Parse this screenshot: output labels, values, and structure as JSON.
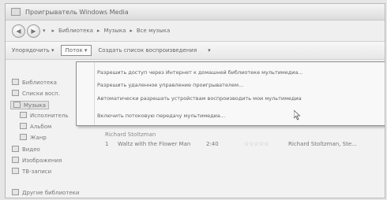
{
  "window": {
    "title": "Проигрыватель Windows Media"
  },
  "nav": {
    "back_glyph": "◀",
    "forward_glyph": "▶",
    "dropdown_glyph": "▾",
    "breadcrumbs": [
      "▸",
      "Библиотека",
      "▸",
      "Музыка",
      "▸",
      "Все музыка"
    ]
  },
  "toolbar": {
    "organize": "Упорядочить ▾",
    "stream": "Поток ▾",
    "create_playlist": "Создать список воспроизведения",
    "more": "▾"
  },
  "sidebar": {
    "items": [
      {
        "label": "Библиотека",
        "icon": "library-icon"
      },
      {
        "label": "Списки восп.",
        "icon": "playlist-icon"
      },
      {
        "label": "Музыка",
        "icon": "music-icon"
      },
      {
        "label": "Исполнитель",
        "icon": "artist-icon"
      },
      {
        "label": "Альбом",
        "icon": "album-icon"
      },
      {
        "label": "Жанр",
        "icon": "genre-icon"
      },
      {
        "label": "Видео",
        "icon": "video-icon"
      },
      {
        "label": "Изображения",
        "icon": "picture-icon"
      },
      {
        "label": "ТВ-записи",
        "icon": "tv-icon"
      },
      {
        "label": "Другие библиотеки",
        "icon": "other-libraries-icon"
      }
    ]
  },
  "library": {
    "album_artist": "Richard Stoltzman",
    "track": {
      "number": "1",
      "title": "Waltz with the Flower Man",
      "length": "2:40",
      "rating": "☆☆☆☆☆",
      "contributing_artist": "Richard Stoltzman, Ste..."
    }
  },
  "stream_menu": {
    "items": [
      "Разрешить доступ через Интернет к домашней библиотеке мультимедиа...",
      "Разрешить удаленное управление проигрывателем...",
      "Автоматически разрешать устройствам воспроизводить мои мультимедиа",
      "Включить потоковую передачу мультимедиа..."
    ]
  },
  "colors": {
    "menu_bg": "#f8f8f8",
    "window_bg": "#f2f2f2"
  }
}
